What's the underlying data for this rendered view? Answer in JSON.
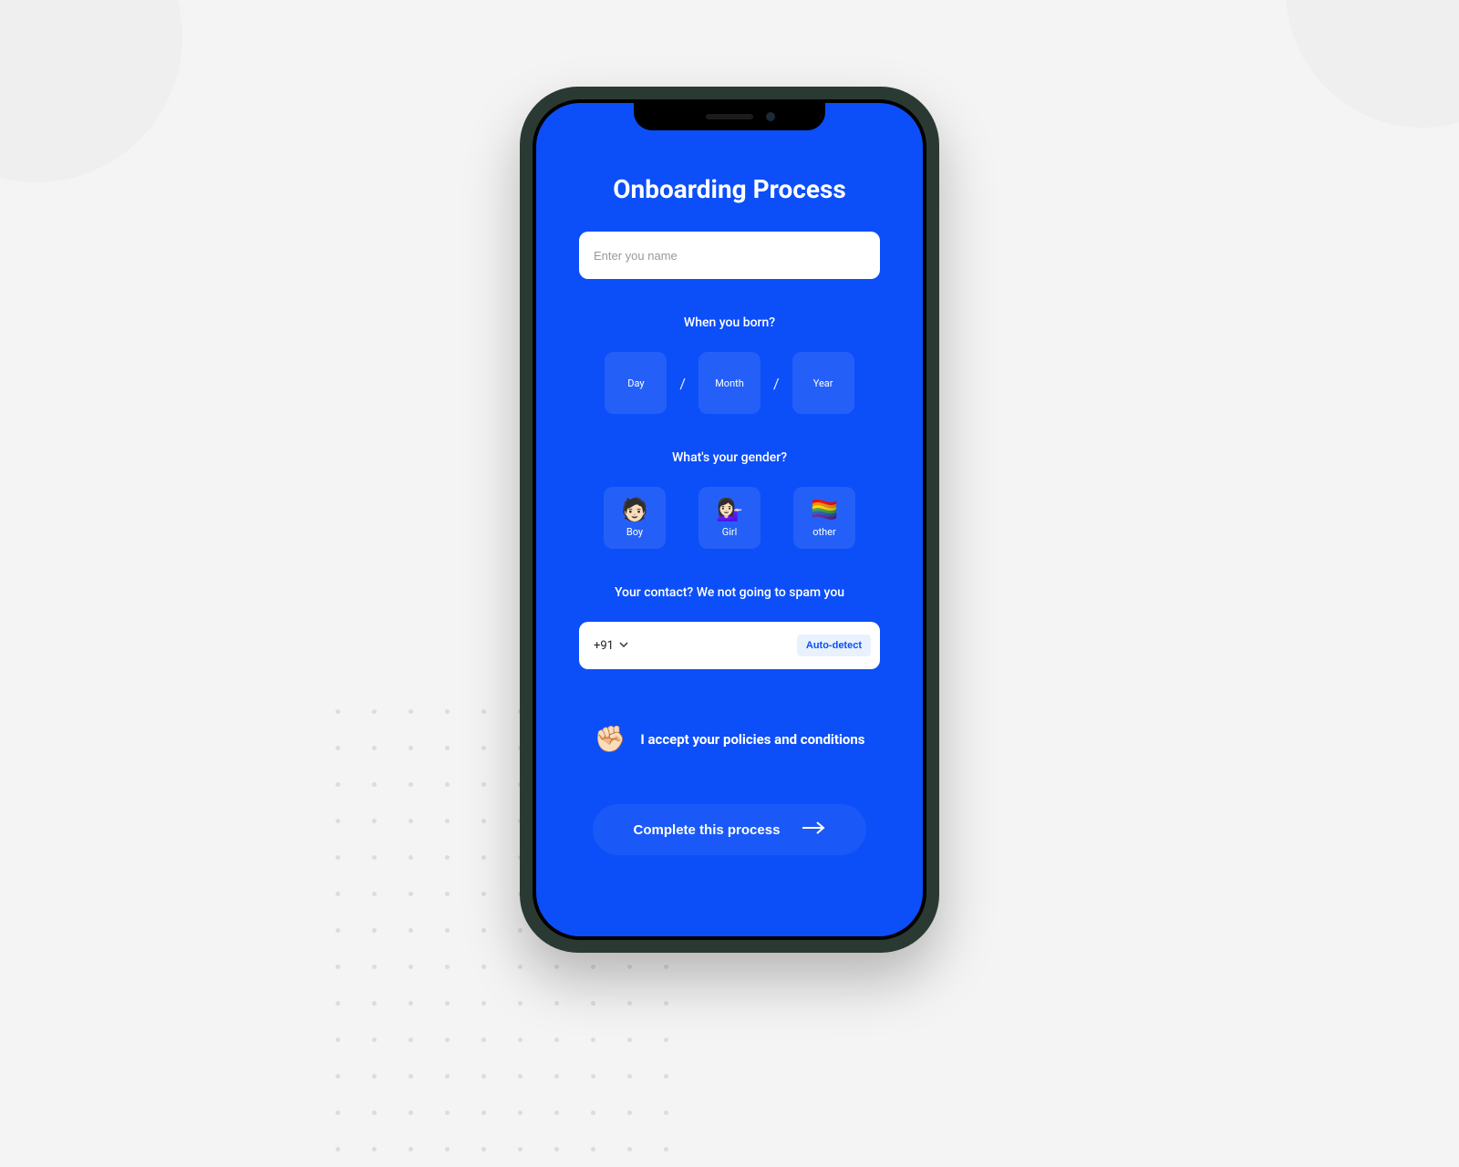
{
  "title": "Onboarding Process",
  "name_input": {
    "placeholder": "Enter you name"
  },
  "dob": {
    "label": "When you born?",
    "day": "Day",
    "month": "Month",
    "year": "Year",
    "separator": "/"
  },
  "gender": {
    "label": "What's your gender?",
    "options": [
      {
        "label": "Boy",
        "emoji": "🧑🏻"
      },
      {
        "label": "Girl",
        "emoji": "💁🏻‍♀️"
      },
      {
        "label": "other",
        "emoji": "🏳️‍🌈"
      }
    ]
  },
  "contact": {
    "label": "Your contact? We not going to spam you",
    "country_code": "+91",
    "autodetect": "Auto-detect"
  },
  "consent": {
    "emoji": "✊🏻",
    "text": "I accept your policies and conditions"
  },
  "submit": "Complete this process"
}
